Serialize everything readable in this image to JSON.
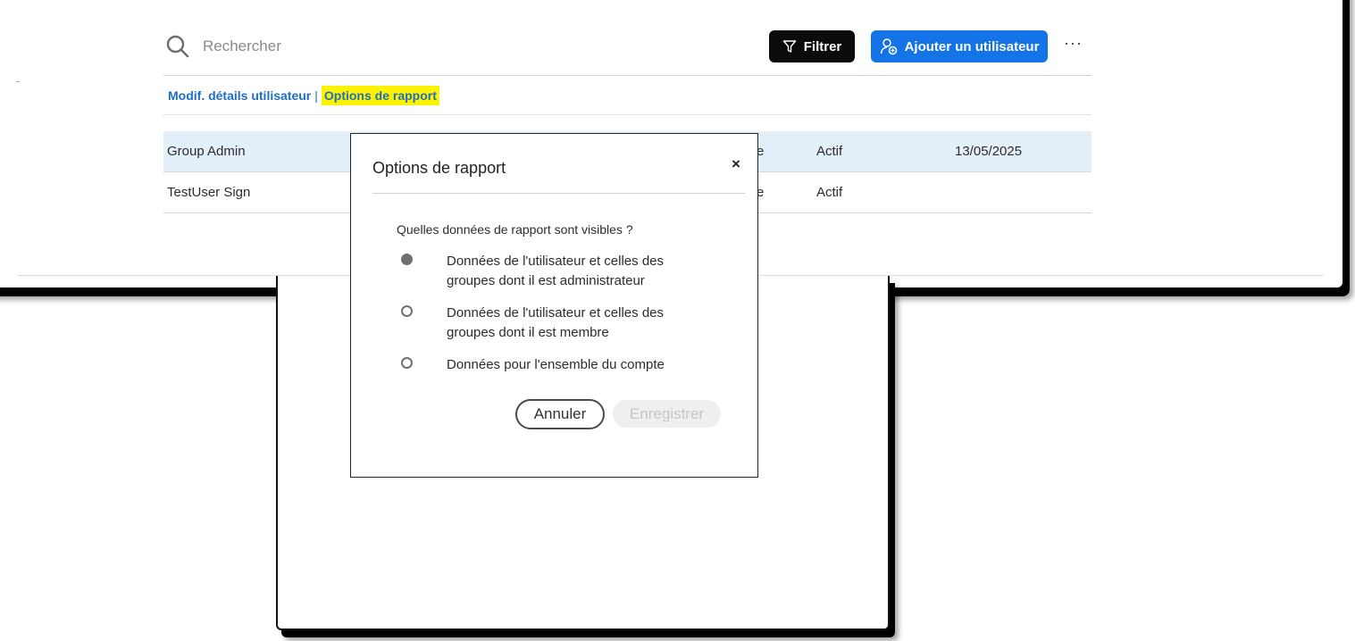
{
  "toolbar": {
    "search_placeholder": "Rechercher",
    "filter_label": "Filtrer",
    "add_user_label": "Ajouter un utilisateur",
    "more_label": "···"
  },
  "actions": {
    "edit_details": "Modif. détails utilisateur",
    "separator": "|",
    "report_options": "Options de rapport"
  },
  "table": {
    "rows": [
      {
        "name": "Group Admin",
        "role_fragment": "e",
        "status": "Actif",
        "date": "13/05/2025"
      },
      {
        "name": "TestUser Sign",
        "role_fragment": "e",
        "status": "Actif",
        "date": ""
      }
    ]
  },
  "modal": {
    "title": "Options de rapport",
    "close": "×",
    "question": "Quelles données de rapport sont visibles ?",
    "options": [
      {
        "label": "Données de l'utilisateur et celles des groupes dont il est administrateur",
        "selected": true
      },
      {
        "label": "Données de l'utilisateur et celles des groupes dont il est membre",
        "selected": false
      },
      {
        "label": "Données pour l'ensemble du compte",
        "selected": false
      }
    ],
    "cancel_label": "Annuler",
    "save_label": "Enregistrer"
  },
  "colors": {
    "primary": "#1473e6",
    "filter_bg": "#0b0b0b",
    "highlight": "#fff200",
    "selected_row": "#e3eff9",
    "link": "#1c6fc4"
  }
}
